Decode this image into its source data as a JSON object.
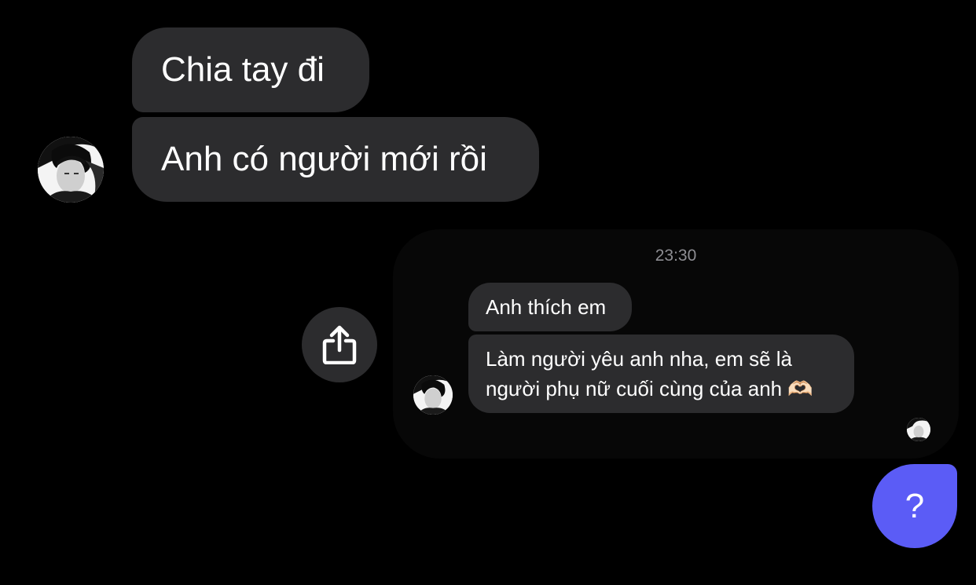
{
  "conversation": {
    "messages": [
      {
        "text": "Chia tay đi"
      },
      {
        "text": "Anh có người mới rồi"
      }
    ]
  },
  "reply_preview": {
    "timestamp": "23:30",
    "messages": [
      {
        "text": "Anh thích em"
      },
      {
        "lines": [
          "Làm người yêu anh nha, em sẽ là",
          "người phụ nữ cuối cùng của anh 🫶🏻"
        ]
      }
    ]
  },
  "icons": {
    "share": "share-icon",
    "help": "?"
  },
  "colors": {
    "background": "#000000",
    "bubble": "#2c2c2e",
    "help_button": "#5b5cf6",
    "timestamp": "#8e8e93"
  }
}
